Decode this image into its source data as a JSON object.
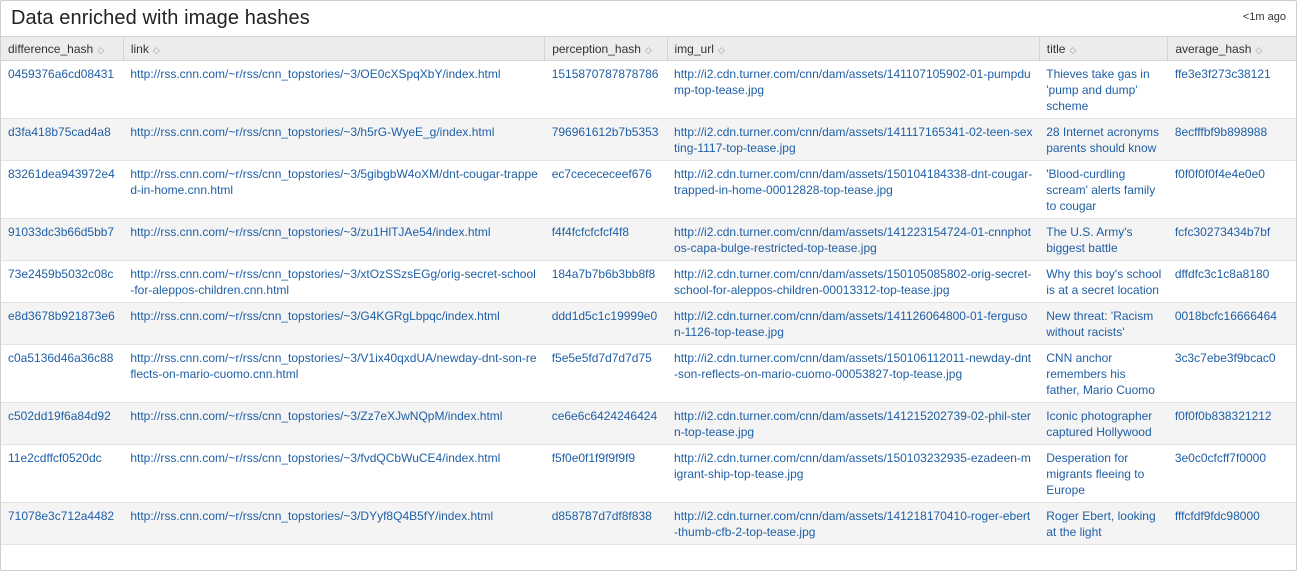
{
  "panel": {
    "title": "Data enriched with image hashes",
    "time": "<1m ago"
  },
  "columns": [
    "difference_hash",
    "link",
    "perception_hash",
    "img_url",
    "title",
    "average_hash"
  ],
  "sort_icon": "sort-icon",
  "rows": [
    {
      "difference_hash": "0459376a6cd08431",
      "link": "http://rss.cnn.com/~r/rss/cnn_topstories/~3/OE0cXSpqXbY/index.html",
      "perception_hash": "1515870787878786",
      "img_url": "http://i2.cdn.turner.com/cnn/dam/assets/141107105902-01-pumpdump-top-tease.jpg",
      "title": "Thieves take gas in 'pump and dump' scheme",
      "average_hash": "ffe3e3f273c38121"
    },
    {
      "difference_hash": "d3fa418b75cad4a8",
      "link": "http://rss.cnn.com/~r/rss/cnn_topstories/~3/h5rG-WyeE_g/index.html",
      "perception_hash": "796961612b7b5353",
      "img_url": "http://i2.cdn.turner.com/cnn/dam/assets/141117165341-02-teen-sexting-1117-top-tease.jpg",
      "title": "28 Internet acronyms parents should know",
      "average_hash": "8ecfffbf9b898988"
    },
    {
      "difference_hash": "83261dea943972e4",
      "link": "http://rss.cnn.com/~r/rss/cnn_topstories/~3/5gibgbW4oXM/dnt-cougar-trapped-in-home.cnn.html",
      "perception_hash": "ec7cecececeef676",
      "img_url": "http://i2.cdn.turner.com/cnn/dam/assets/150104184338-dnt-cougar-trapped-in-home-00012828-top-tease.jpg",
      "title": "'Blood-curdling scream' alerts family to cougar",
      "average_hash": "f0f0f0f0f4e4e0e0"
    },
    {
      "difference_hash": "91033dc3b66d5bb7",
      "link": "http://rss.cnn.com/~r/rss/cnn_topstories/~3/zu1HlTJAe54/index.html",
      "perception_hash": "f4f4fcfcfcfcf4f8",
      "img_url": "http://i2.cdn.turner.com/cnn/dam/assets/141223154724-01-cnnphotos-capa-bulge-restricted-top-tease.jpg",
      "title": "The U.S. Army's biggest battle",
      "average_hash": "fcfc30273434b7bf"
    },
    {
      "difference_hash": "73e2459b5032c08c",
      "link": "http://rss.cnn.com/~r/rss/cnn_topstories/~3/xtOzSSzsEGg/orig-secret-school-for-aleppos-children.cnn.html",
      "perception_hash": "184a7b7b6b3bb8f8",
      "img_url": "http://i2.cdn.turner.com/cnn/dam/assets/150105085802-orig-secret-school-for-aleppos-children-00013312-top-tease.jpg",
      "title": "Why this boy's school is at a secret location",
      "average_hash": "dffdfc3c1c8a8180"
    },
    {
      "difference_hash": "e8d3678b921873e6",
      "link": "http://rss.cnn.com/~r/rss/cnn_topstories/~3/G4KGRgLbpqc/index.html",
      "perception_hash": "ddd1d5c1c19999e0",
      "img_url": "http://i2.cdn.turner.com/cnn/dam/assets/141126064800-01-ferguson-1126-top-tease.jpg",
      "title": "New threat: 'Racism without racists'",
      "average_hash": "0018bcfc16666464"
    },
    {
      "difference_hash": "c0a5136d46a36c88",
      "link": "http://rss.cnn.com/~r/rss/cnn_topstories/~3/V1ix40qxdUA/newday-dnt-son-reflects-on-mario-cuomo.cnn.html",
      "perception_hash": "f5e5e5fd7d7d7d75",
      "img_url": "http://i2.cdn.turner.com/cnn/dam/assets/150106112011-newday-dnt-son-reflects-on-mario-cuomo-00053827-top-tease.jpg",
      "title": "CNN anchor remembers his father, Mario Cuomo",
      "average_hash": "3c3c7ebe3f9bcac0"
    },
    {
      "difference_hash": "c502dd19f6a84d92",
      "link": "http://rss.cnn.com/~r/rss/cnn_topstories/~3/Zz7eXJwNQpM/index.html",
      "perception_hash": "ce6e6c6424246424",
      "img_url": "http://i2.cdn.turner.com/cnn/dam/assets/141215202739-02-phil-stern-top-tease.jpg",
      "title": "Iconic photographer captured Hollywood",
      "average_hash": "f0f0f0b838321212"
    },
    {
      "difference_hash": "11e2cdffcf0520dc",
      "link": "http://rss.cnn.com/~r/rss/cnn_topstories/~3/fvdQCbWuCE4/index.html",
      "perception_hash": "f5f0e0f1f9f9f9f9",
      "img_url": "http://i2.cdn.turner.com/cnn/dam/assets/150103232935-ezadeen-migrant-ship-top-tease.jpg",
      "title": "Desperation for migrants fleeing to Europe",
      "average_hash": "3e0c0cfcff7f0000"
    },
    {
      "difference_hash": "71078e3c712a4482",
      "link": "http://rss.cnn.com/~r/rss/cnn_topstories/~3/DYyf8Q4B5fY/index.html",
      "perception_hash": "d858787d7df8f838",
      "img_url": "http://i2.cdn.turner.com/cnn/dam/assets/141218170410-roger-ebert-thumb-cfb-2-top-tease.jpg",
      "title": "Roger Ebert, looking at the light",
      "average_hash": "fffcfdf9fdc98000"
    }
  ]
}
